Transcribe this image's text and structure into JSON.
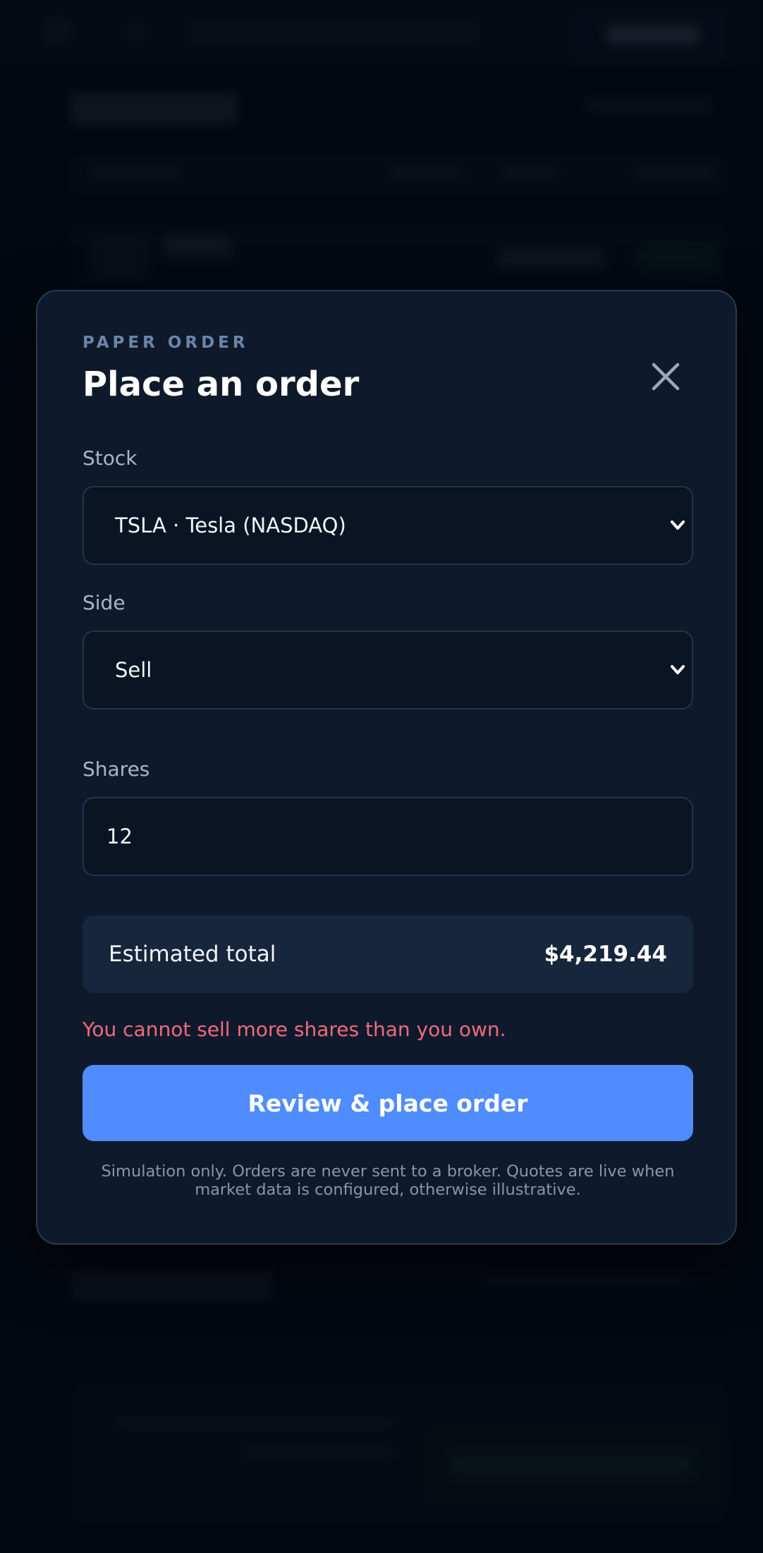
{
  "modal": {
    "eyebrow": "PAPER ORDER",
    "title": "Place an order",
    "close_icon": "close-icon"
  },
  "form": {
    "stock": {
      "label": "Stock",
      "value": "TSLA · Tesla (NASDAQ)",
      "icon": "chevron-down-icon"
    },
    "side": {
      "label": "Side",
      "value": "Sell",
      "icon": "chevron-down-icon"
    },
    "shares": {
      "label": "Shares",
      "value": "12"
    }
  },
  "summary": {
    "label": "Estimated total",
    "value": "$4,219.44"
  },
  "error": "You cannot sell more shares than you own.",
  "actions": {
    "submit_label": "Review & place order"
  },
  "disclaimer": "Simulation only. Orders are never sent to a broker. Quotes are live when market data is configured, otherwise illustrative.",
  "colors": {
    "accent": "#4f8cff",
    "error": "#f06a7e",
    "modal_bg": "#0e1a2b",
    "page_bg": "#050a13"
  }
}
